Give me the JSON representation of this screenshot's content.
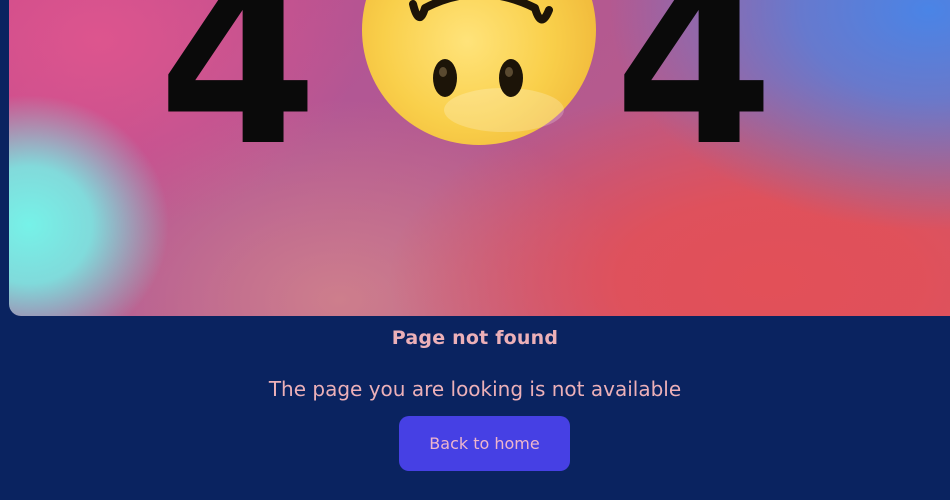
{
  "hero": {
    "digit_left": "4",
    "digit_right": "4",
    "emoji": "upside-down-face-emoji"
  },
  "message": {
    "title": "Page not found",
    "subtitle": "The page you are looking is not available"
  },
  "actions": {
    "back_home_label": "Back to home"
  },
  "colors": {
    "page_background": "#0a2360",
    "text": "#ecb0b8",
    "button": "#4640e4"
  }
}
